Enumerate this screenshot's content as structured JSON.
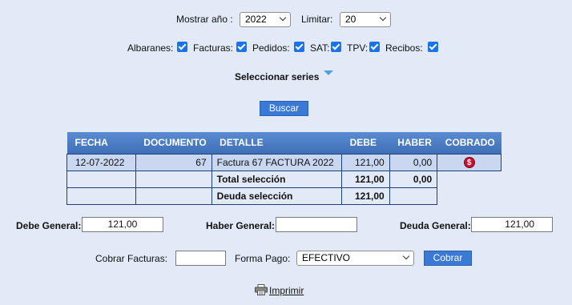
{
  "filters": {
    "year_label": "Mostrar año :",
    "year_value": "2022",
    "limit_label": "Limitar:",
    "limit_value": "20"
  },
  "types": [
    {
      "label": "Albaranes:",
      "checked": true
    },
    {
      "label": "Facturas:",
      "checked": true
    },
    {
      "label": "Pedidos:",
      "checked": true
    },
    {
      "label": "SAT:",
      "checked": true
    },
    {
      "label": "TPV:",
      "checked": true
    },
    {
      "label": "Recibos:",
      "checked": true
    }
  ],
  "series_label": "Seleccionar series",
  "search_button": "Buscar",
  "table": {
    "headers": [
      "FECHA",
      "DOCUMENTO",
      "DETALLE",
      "DEBE",
      "HABER",
      "COBRADO"
    ],
    "row": {
      "fecha": "12-07-2022",
      "documento": "67",
      "detalle": "Factura 67 FACTURA 2022",
      "debe": "121,00",
      "haber": "0,00",
      "cobrado_icon": "$"
    },
    "total_label": "Total selección",
    "total_debe": "121,00",
    "total_haber": "0,00",
    "deuda_label": "Deuda selección",
    "deuda_debe": "121,00"
  },
  "summary": {
    "debe_label": "Debe General:",
    "debe_value": "121,00",
    "haber_label": "Haber General:",
    "haber_value": "",
    "deuda_label": "Deuda General:",
    "deuda_value": "121,00"
  },
  "payment": {
    "cobrar_label": "Cobrar Facturas:",
    "cobrar_value": "",
    "forma_label": "Forma Pago:",
    "forma_value": "EFECTIVO",
    "cobrar_button": "Cobrar"
  },
  "print_label": "Imprimir",
  "colors": {
    "background": "#e1eaf6",
    "header": "#4a7cc4",
    "row": "#c9d8f0",
    "button": "#3b79d6",
    "checkbox": "#1a73e8"
  }
}
